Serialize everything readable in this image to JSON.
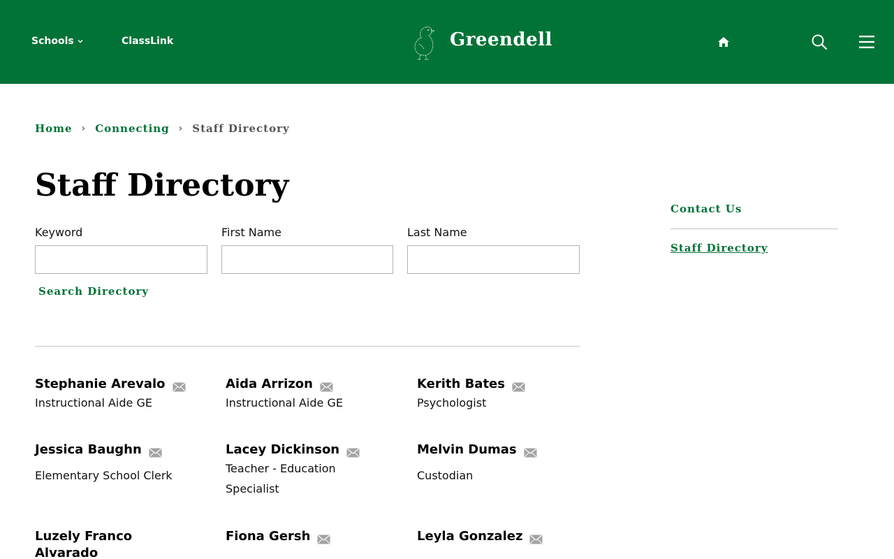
{
  "header": {
    "nav_schools": "Schools",
    "nav_classlink": "ClassLink",
    "brand": "Greendell",
    "bg_color": "#027337"
  },
  "breadcrumb": {
    "home": "Home",
    "connecting": "Connecting",
    "current": "Staff Directory"
  },
  "page_title": "Staff Directory",
  "form": {
    "keyword_label": "Keyword",
    "keyword_value": "",
    "first_name_label": "First Name",
    "first_name_value": "",
    "last_name_label": "Last Name",
    "last_name_value": "",
    "search_button": "Search Directory"
  },
  "staff": [
    {
      "name": "Stephanie Arevalo",
      "role": "Instructional Aide GE"
    },
    {
      "name": "Aida Arrizon",
      "role": "Instructional Aide GE"
    },
    {
      "name": "Kerith Bates",
      "role": "Psychologist"
    },
    {
      "name": "Jessica Baughn",
      "role": "Elementary School Clerk"
    },
    {
      "name": "Lacey Dickinson",
      "role": "Teacher - Education Specialist"
    },
    {
      "name": "Melvin Dumas",
      "role": "Custodian"
    },
    {
      "name": "Luzely Franco Alvarado",
      "role": ""
    },
    {
      "name": "Fiona Gersh",
      "role": ""
    },
    {
      "name": "Leyla Gonzalez",
      "role": ""
    }
  ],
  "sidebar": {
    "contact_us": "Contact Us",
    "staff_directory": "Staff Directory"
  },
  "icons": {
    "home": "home-icon",
    "search": "search-icon",
    "menu": "hamburger-menu-icon",
    "mail": "mail-icon",
    "chevron": "chevron-down-icon",
    "logo": "duck-logo-icon"
  }
}
